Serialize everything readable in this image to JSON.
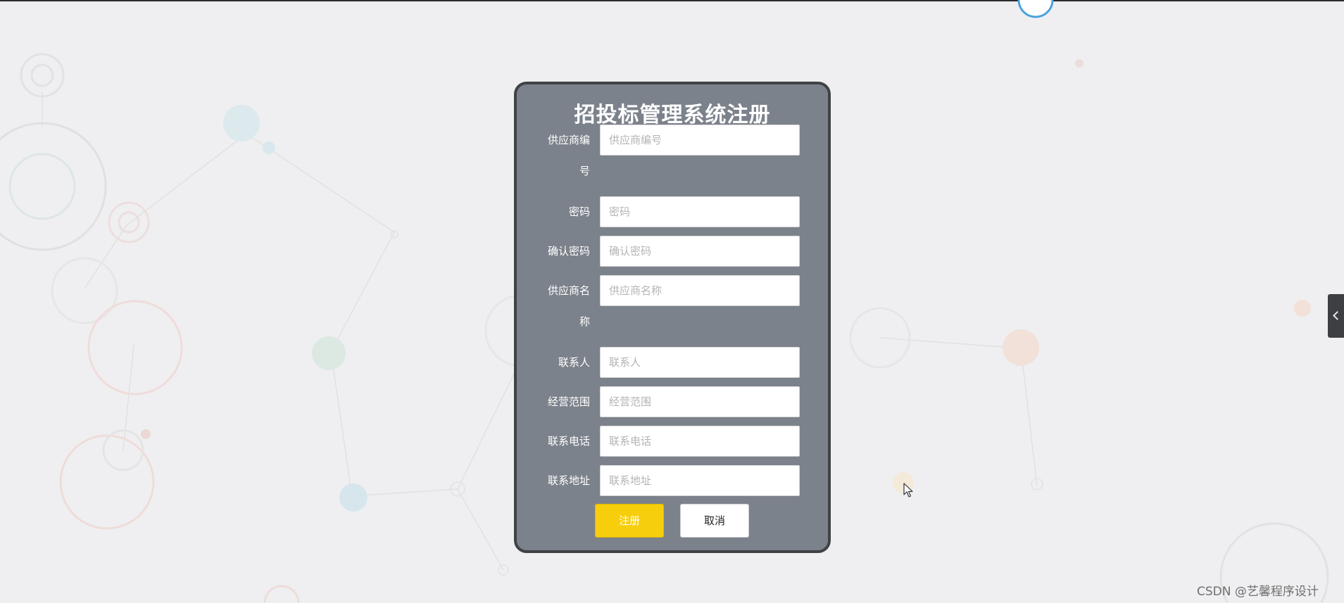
{
  "form": {
    "title": "招投标管理系统注册",
    "fields": [
      {
        "label": "供应商编号",
        "placeholder": "供应商编号"
      },
      {
        "label": "密码",
        "placeholder": "密码"
      },
      {
        "label": "确认密码",
        "placeholder": "确认密码"
      },
      {
        "label": "供应商名称",
        "placeholder": "供应商名称"
      },
      {
        "label": "联系人",
        "placeholder": "联系人"
      },
      {
        "label": "经营范围",
        "placeholder": "经营范围"
      },
      {
        "label": "联系电话",
        "placeholder": "联系电话"
      },
      {
        "label": "联系地址",
        "placeholder": "联系地址"
      }
    ],
    "register_label": "注册",
    "cancel_label": "取消"
  },
  "watermark": "CSDN @艺馨程序设计",
  "icons": {
    "side_toggle": "chevron-left-icon",
    "cursor": "mouse-pointer-icon"
  },
  "colors": {
    "card_bg": "#7c828b",
    "primary_button": "#f7ce0b",
    "page_bg": "#efeff1"
  }
}
